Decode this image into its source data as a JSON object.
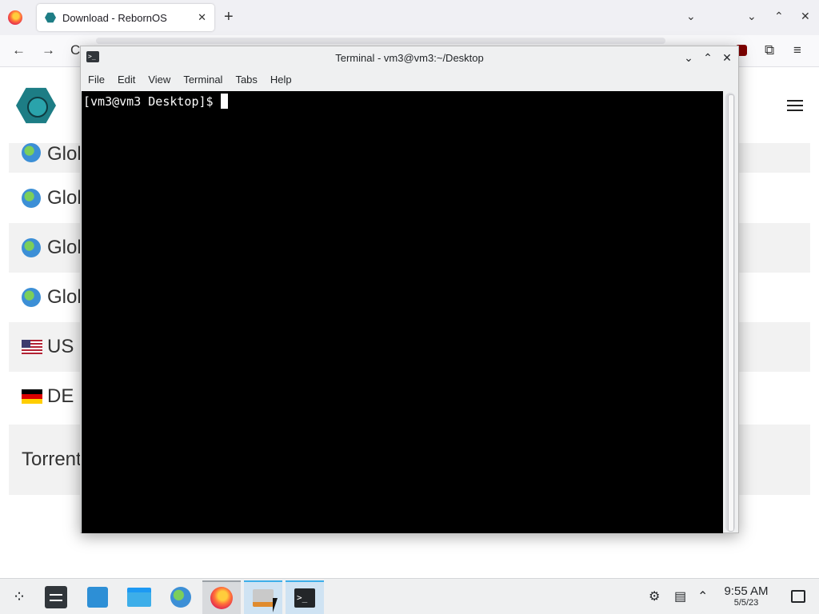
{
  "browser": {
    "tab_title": "Download - RebornOS",
    "tab_close": "✕",
    "new_tab": "+",
    "tab_list": "⌄",
    "window_controls": {
      "minimize": "⌄",
      "maximize": "⌃",
      "close": "✕"
    },
    "nav": {
      "back": "←",
      "forward": "→",
      "reload": "C"
    },
    "extensions_icon": "puzzle-icon",
    "menu_icon": "hamburger-icon"
  },
  "page": {
    "mirrors": [
      {
        "label": "Glol",
        "icon": "globe-icon"
      },
      {
        "label": "Glol",
        "icon": "globe-icon"
      },
      {
        "label": "Glol",
        "icon": "globe-icon"
      },
      {
        "label": "Glol",
        "icon": "globe-icon"
      },
      {
        "label": "US",
        "icon": "us-flag-icon"
      },
      {
        "label": "DE",
        "icon": "de-flag-icon"
      }
    ],
    "torrent_label": "Torrent"
  },
  "terminal": {
    "title": "Terminal - vm3@vm3:~/Desktop",
    "menu": [
      "File",
      "Edit",
      "View",
      "Terminal",
      "Tabs",
      "Help"
    ],
    "prompt": "[vm3@vm3 Desktop]$",
    "controls": {
      "minimize": "⌄",
      "maximize": "⌃",
      "close": "✕"
    }
  },
  "taskbar": {
    "clock_time": "9:55 AM",
    "clock_date": "5/5/23",
    "apps": [
      "launcher",
      "system-settings",
      "discover",
      "files",
      "browser",
      "firefox",
      "tool",
      "terminal"
    ]
  },
  "colors": {
    "accent": "#3daee9",
    "terminal_bg": "#000000",
    "brand_teal": "#1d7d85"
  }
}
